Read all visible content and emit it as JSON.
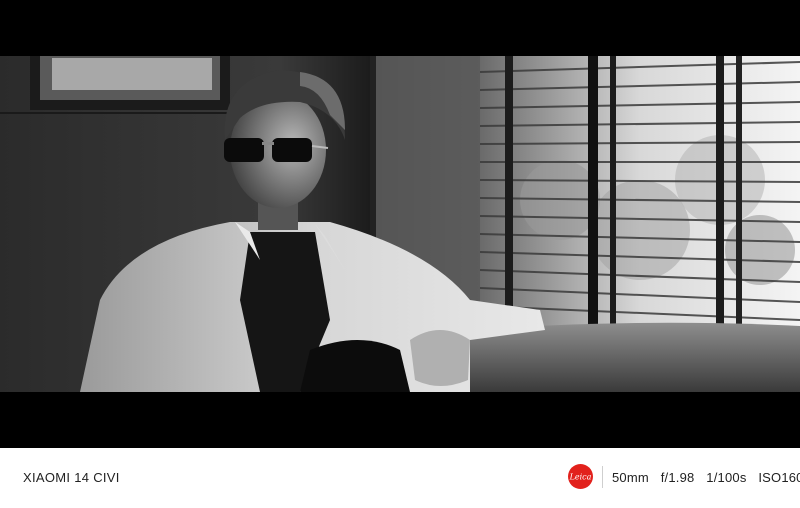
{
  "photo": {
    "style": "black-and-white cinematic portrait",
    "subject": "young man in sunglasses and light jacket seated by window blinds"
  },
  "watermark": {
    "device_name": "XIAOMI 14 CIVI",
    "brand_logo_text": "Leica",
    "brand_logo_color": "#e2211c",
    "exif": {
      "focal_length": "50mm",
      "aperture": "f/1.98",
      "shutter": "1/100s",
      "iso": "ISO160"
    }
  }
}
